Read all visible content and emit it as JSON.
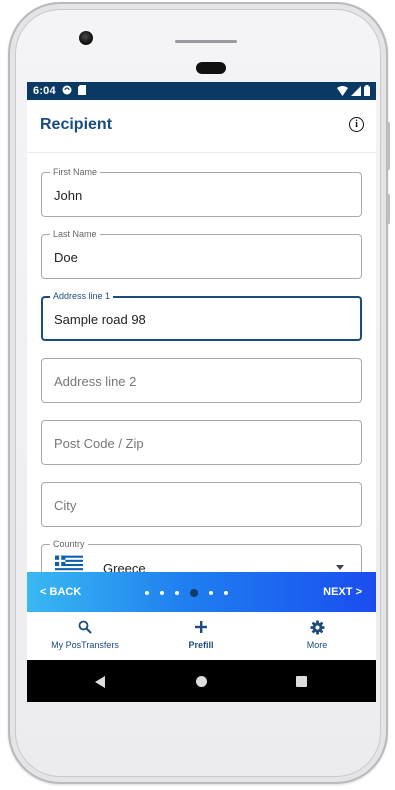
{
  "statusbar": {
    "time": "6:04",
    "icons_left": [
      "sync-icon",
      "sd-card-icon"
    ],
    "icons_right": [
      "wifi-icon",
      "signal-icon",
      "battery-icon"
    ]
  },
  "appbar": {
    "title": "Recipient",
    "info_icon": "info-icon"
  },
  "form": {
    "first_name": {
      "label": "First Name",
      "value": "John"
    },
    "last_name": {
      "label": "Last Name",
      "value": "Doe"
    },
    "address1": {
      "label": "Address line 1",
      "value": "Sample road 98"
    },
    "address2": {
      "placeholder": "Address line 2"
    },
    "postcode": {
      "placeholder": "Post Code / Zip"
    },
    "city": {
      "placeholder": "City"
    },
    "country": {
      "label": "Country",
      "value": "Greece",
      "flag": "greece-flag-icon"
    }
  },
  "wizard": {
    "back_label": "BACK",
    "next_label": "NEXT",
    "steps_total": 6,
    "current_step": 4
  },
  "bottom_nav": {
    "items": [
      {
        "label": "My PosTransfers",
        "icon": "search-icon",
        "active": false
      },
      {
        "label": "Prefill",
        "icon": "plus-icon",
        "active": true
      },
      {
        "label": "More",
        "icon": "gear-icon",
        "active": false
      }
    ]
  },
  "colors": {
    "primary": "#1b4c7d",
    "status_bar": "#0a3a63",
    "wizard_gradient_start": "#39b8f2",
    "wizard_gradient_end": "#1a4df0"
  }
}
